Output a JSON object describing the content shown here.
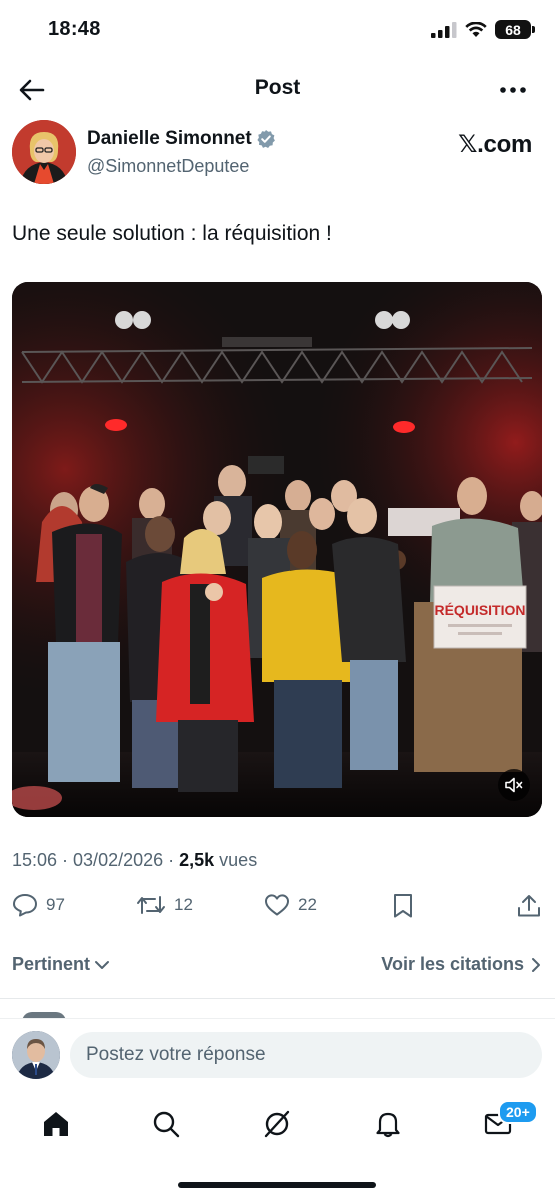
{
  "status_bar": {
    "time": "18:48",
    "battery": "68"
  },
  "header": {
    "title": "Post",
    "back_icon": "arrow-left-icon",
    "more_icon": "more-horizontal-icon"
  },
  "author": {
    "name": "Danielle Simonnet",
    "handle": "@SimonnetDeputee",
    "verified": true,
    "source": "𝕏.com"
  },
  "tweet": {
    "text": "Une seule solution : la réquisition !",
    "media": {
      "sign_text": "RÉQUISITION",
      "mute_icon": "speaker-muted-icon"
    }
  },
  "meta": {
    "datetime": "15:06 · 03/02/2026 · ",
    "views_count": "2,5k",
    "views_label": " vues"
  },
  "actions": {
    "replies": "97",
    "reposts": "12",
    "likes": "22"
  },
  "sort": {
    "left_label": "Pertinent",
    "right_label": "Voir les citations"
  },
  "composer": {
    "placeholder": "Postez votre réponse"
  },
  "bottom_nav": {
    "messages_badge": "20+"
  },
  "colors": {
    "accent": "#1d9bf0",
    "text_primary": "#0f1419",
    "text_secondary": "#536471"
  }
}
